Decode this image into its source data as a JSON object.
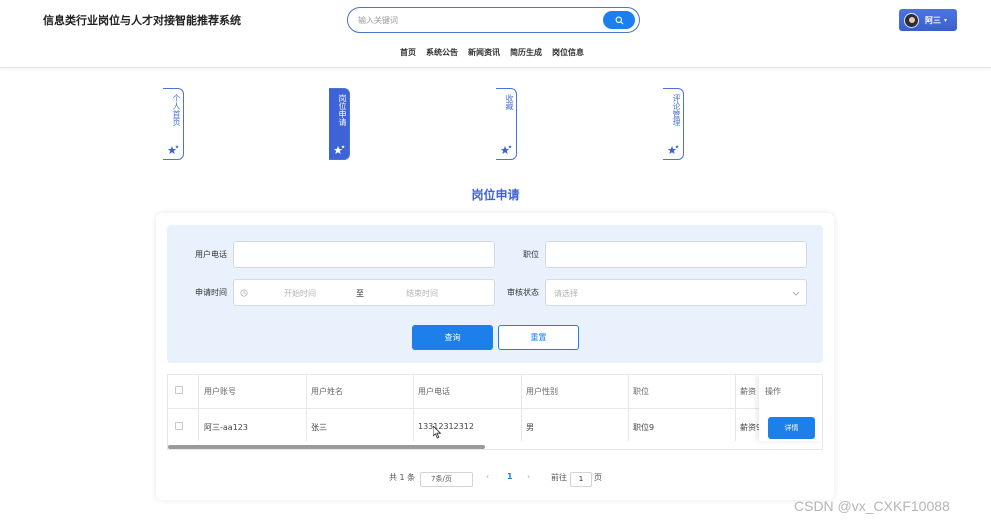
{
  "header": {
    "site_title": "信息类行业岗位与人才对接智能推荐系统",
    "search": {
      "placeholder": "输入关键词"
    },
    "user": {
      "name": "阿三",
      "caret": "▾"
    },
    "nav": [
      "首页",
      "系统公告",
      "新闻资讯",
      "简历生成",
      "岗位信息"
    ]
  },
  "tabs": [
    {
      "label": "个人首页",
      "active": false
    },
    {
      "label": "岗位申请",
      "active": true
    },
    {
      "label": "收藏",
      "active": false
    },
    {
      "label": "评论管理",
      "active": false
    }
  ],
  "page_title": "岗位申请",
  "filters": {
    "phone_label": "用户电话",
    "phone_value": "",
    "position_label": "职位",
    "position_value": "",
    "date_label": "申请时间",
    "date_start_placeholder": "开始时间",
    "date_separator": "至",
    "date_end_placeholder": "结束时间",
    "status_label": "审核状态",
    "status_placeholder": "请选择",
    "query_button": "查询",
    "reset_button": "重置"
  },
  "table": {
    "headers": [
      "用户账号",
      "用户姓名",
      "用户电话",
      "用户性别",
      "职位",
      "薪资",
      "操作"
    ],
    "rows": [
      {
        "account": "阿三-aa123",
        "name": "张三",
        "phone": "13312312312",
        "gender": "男",
        "position": "职位9",
        "salary": "薪资9",
        "action": "详情"
      }
    ]
  },
  "pagination": {
    "total": "共 1 条",
    "page_size": "7条/页",
    "prev": "‹",
    "current": "1",
    "next": "›",
    "goto_label": "前往",
    "goto_value": "1",
    "goto_suffix": "页"
  },
  "watermark": "CSDN @vx_CXKF10088",
  "colors": {
    "primary": "#1c7fea",
    "accent": "#3e63d6",
    "filter_bg": "#e8f1fc"
  }
}
